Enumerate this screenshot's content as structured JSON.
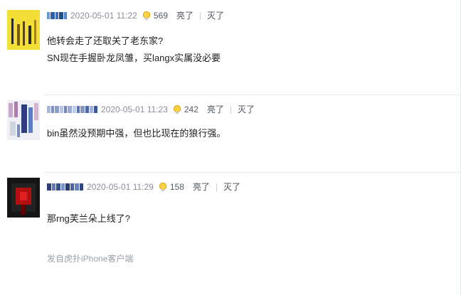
{
  "comments": [
    {
      "time": "2020-05-01 11:22",
      "lights": "569",
      "light_label": "亮了",
      "separator": "|",
      "dark_label": "灭了",
      "lines": [
        "他转会走了还取关了老东家?",
        "SN现在手握卧龙凤雏，买langx实属没必要"
      ]
    },
    {
      "time": "2020-05-01 11:23",
      "lights": "242",
      "light_label": "亮了",
      "separator": "|",
      "dark_label": "灭了",
      "lines": [
        "bin虽然没预期中强，但也比现在的狼行强。"
      ]
    },
    {
      "time": "2020-05-01 11:29",
      "lights": "158",
      "light_label": "亮了",
      "separator": "|",
      "dark_label": "灭了",
      "lines": [
        "那rng芙兰朵上线了?"
      ]
    }
  ],
  "footer": "发自虎扑iPhone客户端",
  "icons": {
    "light": "lightbulb-icon"
  },
  "colors": {
    "bulb": "#f0b400",
    "meta": "#8a8f99"
  }
}
